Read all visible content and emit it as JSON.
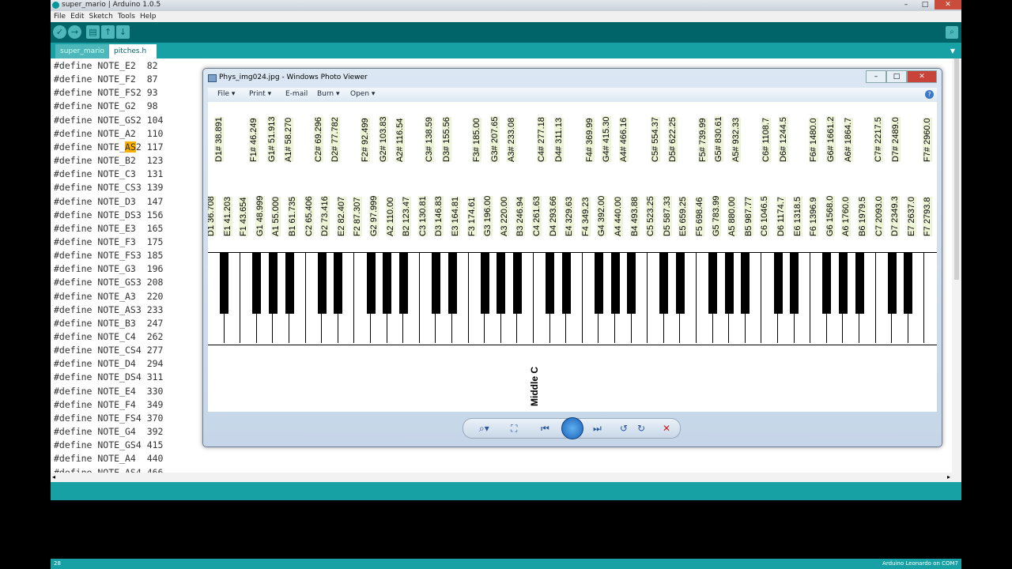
{
  "window": {
    "title": "super_mario | Arduino 1.0.5"
  },
  "titlebar_buttons": [
    "–",
    "□",
    "✕"
  ],
  "menu": [
    "File",
    "Edit",
    "Sketch",
    "Tools",
    "Help"
  ],
  "toolbar": {
    "verify": "✓",
    "upload": "→",
    "new": "▤",
    "open": "↑",
    "save": "↓",
    "serial": "⌕"
  },
  "tabs": [
    {
      "label": "super_mario §"
    },
    {
      "label": "pitches.h"
    }
  ],
  "tab_menu": "▼",
  "code": [
    {
      "pre": "#define NOTE_E2  82",
      "hl": "",
      "post": ""
    },
    {
      "pre": "#define NOTE_F2  87",
      "hl": "",
      "post": ""
    },
    {
      "pre": "#define NOTE_FS2 93",
      "hl": "",
      "post": ""
    },
    {
      "pre": "#define NOTE_G2  98",
      "hl": "",
      "post": ""
    },
    {
      "pre": "#define NOTE_GS2 104",
      "hl": "",
      "post": ""
    },
    {
      "pre": "#define NOTE_A2  110",
      "hl": "",
      "post": ""
    },
    {
      "pre": "#define NOTE_",
      "hl": "AS",
      "post": "2 117"
    },
    {
      "pre": "#define NOTE_B2  123",
      "hl": "",
      "post": ""
    },
    {
      "pre": "#define NOTE_C3  131",
      "hl": "",
      "post": ""
    },
    {
      "pre": "#define NOTE_CS3 139",
      "hl": "",
      "post": ""
    },
    {
      "pre": "#define NOTE_D3  147",
      "hl": "",
      "post": ""
    },
    {
      "pre": "#define NOTE_DS3 156",
      "hl": "",
      "post": ""
    },
    {
      "pre": "#define NOTE_E3  165",
      "hl": "",
      "post": ""
    },
    {
      "pre": "#define NOTE_F3  175",
      "hl": "",
      "post": ""
    },
    {
      "pre": "#define NOTE_FS3 185",
      "hl": "",
      "post": ""
    },
    {
      "pre": "#define NOTE_G3  196",
      "hl": "",
      "post": ""
    },
    {
      "pre": "#define NOTE_GS3 208",
      "hl": "",
      "post": ""
    },
    {
      "pre": "#define NOTE_A3  220",
      "hl": "",
      "post": ""
    },
    {
      "pre": "#define NOTE_AS3 233",
      "hl": "",
      "post": ""
    },
    {
      "pre": "#define NOTE_B3  247",
      "hl": "",
      "post": ""
    },
    {
      "pre": "#define NOTE_C4  262",
      "hl": "",
      "post": ""
    },
    {
      "pre": "#define NOTE_CS4 277",
      "hl": "",
      "post": ""
    },
    {
      "pre": "#define NOTE_D4  294",
      "hl": "",
      "post": ""
    },
    {
      "pre": "#define NOTE_DS4 311",
      "hl": "",
      "post": ""
    },
    {
      "pre": "#define NOTE_E4  330",
      "hl": "",
      "post": ""
    },
    {
      "pre": "#define NOTE_F4  349",
      "hl": "",
      "post": ""
    },
    {
      "pre": "#define NOTE_FS4 370",
      "hl": "",
      "post": ""
    },
    {
      "pre": "#define NOTE_G4  392",
      "hl": "",
      "post": ""
    },
    {
      "pre": "#define NOTE_GS4 415",
      "hl": "",
      "post": ""
    },
    {
      "pre": "#define NOTE_A4  440",
      "hl": "",
      "post": ""
    },
    {
      "pre": "#define NOTE_AS4 466",
      "hl": "",
      "post": ""
    }
  ],
  "hscroll_arrows": [
    "◂",
    "▸"
  ],
  "status": {
    "line": "28",
    "board": "Arduino Leonardo on COM7"
  },
  "photo_viewer": {
    "title": "Phys_img024.jpg - Windows Photo Viewer",
    "buttons": [
      "–",
      "□",
      "✕"
    ],
    "menu": [
      "File ▾",
      "Print ▾",
      "E-mail",
      "Burn ▾",
      "Open ▾"
    ],
    "help": "?",
    "sharps": [
      "D1# 38.891",
      "F1# 46.249",
      "G1# 51.913",
      "A1# 58.270",
      "C2# 69.296",
      "D2# 77.782",
      "F2# 92.499",
      "G2# 103.83",
      "A2# 116.54",
      "C3# 138.59",
      "D3# 155.56",
      "F3# 185.00",
      "G3# 207.65",
      "A3# 233.08",
      "C4# 277.18",
      "D4# 311.13",
      "F4# 369.99",
      "G4# 415.30",
      "A4# 466.16",
      "C5# 554.37",
      "D5# 622.25",
      "F5# 739.99",
      "G5# 830.61",
      "A5# 932.33",
      "C6# 1108.7",
      "D6# 1244.5",
      "F6# 1480.0",
      "G6# 1661.2",
      "A6# 1864.7",
      "C7# 2217.5",
      "D7# 2489.0",
      "F7# 2960.0"
    ],
    "naturals": [
      "D1 36.708",
      "E1 41.203",
      "F1 43.654",
      "G1 48.999",
      "A1 55.000",
      "B1 61.735",
      "C2 65.406",
      "D2 73.416",
      "E2 82.407",
      "F2 87.307",
      "G2 97.999",
      "A2 110.00",
      "B2 123.47",
      "C3 130.81",
      "D3 146.83",
      "E3 164.81",
      "F3 174.61",
      "G3 196.00",
      "A3 220.00",
      "B3 246.94",
      "C4 261.63",
      "D4 293.66",
      "E4 329.63",
      "F4 349.23",
      "G4 392.00",
      "A4 440.00",
      "B4 493.88",
      "C5 523.25",
      "D5 587.33",
      "E5 659.25",
      "F5 698.46",
      "G5 783.99",
      "A5 880.00",
      "B5 987.77",
      "C6 1046.5",
      "D6 1174.7",
      "E6 1318.5",
      "F6 1396.9",
      "G6 1568.0",
      "A6 1760.0",
      "B6 1979.5",
      "C7 2093.0",
      "D7 2349.3",
      "E7 2637.0",
      "F7 2793.8"
    ],
    "middle_c": "Middle C",
    "nav": {
      "zoom": "⌕▾",
      "fit": "⛶",
      "prev": "⏮",
      "next": "⏭",
      "rotl": "↺",
      "rotr": "↻",
      "del": "✕"
    }
  }
}
